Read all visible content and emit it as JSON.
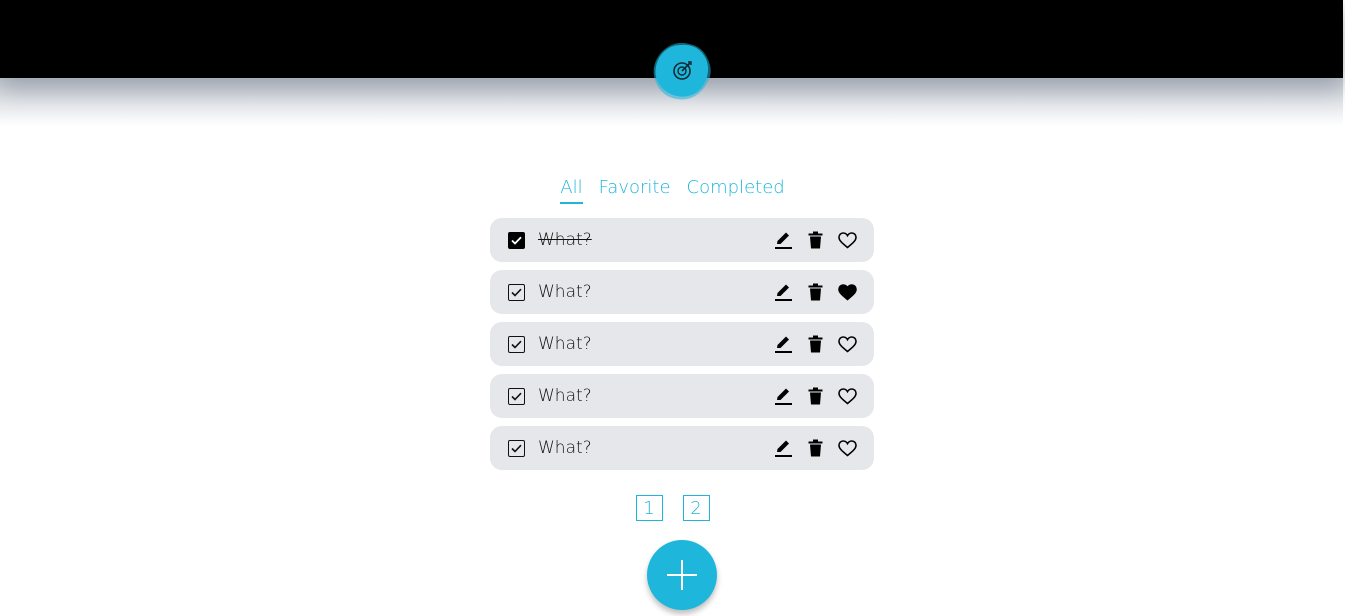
{
  "header": {
    "logo_icon": "target-icon",
    "bar_color": "#000000",
    "accent_color": "#1fb6db"
  },
  "filters": {
    "tabs": [
      {
        "label": "All",
        "active": true
      },
      {
        "label": "Favorite",
        "active": false
      },
      {
        "label": "Completed",
        "active": false
      }
    ]
  },
  "todos": [
    {
      "text": "What?",
      "completed": true,
      "favorite": false
    },
    {
      "text": "What?",
      "completed": false,
      "favorite": true
    },
    {
      "text": "What?",
      "completed": false,
      "favorite": false
    },
    {
      "text": "What?",
      "completed": false,
      "favorite": false
    },
    {
      "text": "What?",
      "completed": false,
      "favorite": false
    }
  ],
  "row_icons": [
    "edit-icon",
    "trash-icon",
    "heart-icon"
  ],
  "pagination": {
    "pages": [
      "1",
      "2"
    ]
  },
  "fab": {
    "icon": "plus-icon"
  }
}
